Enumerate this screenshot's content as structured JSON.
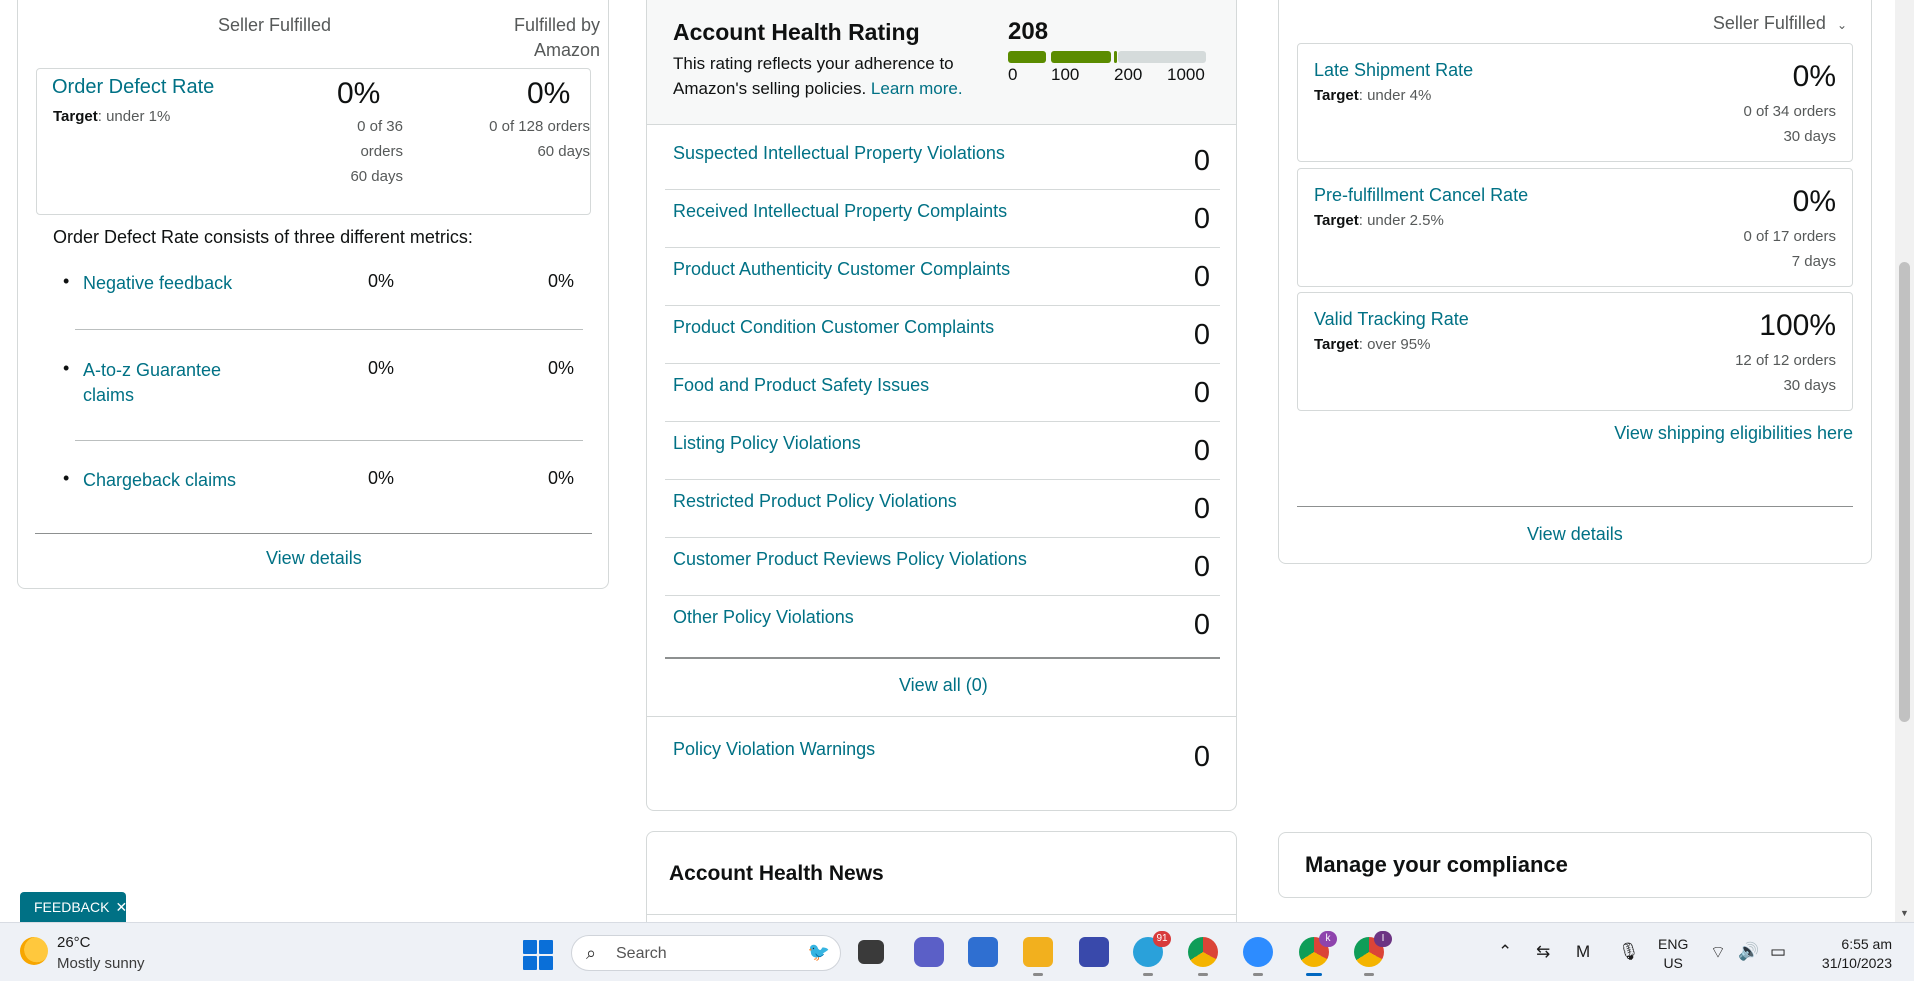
{
  "left_card": {
    "col_seller": "Seller Fulfilled",
    "col_amazon_1": "Fulfilled by",
    "col_amazon_2": "Amazon",
    "odr": {
      "title": "Order Defect Rate",
      "target_label": "Target",
      "target_value": ": under 1%",
      "seller_pct": "0%",
      "seller_meta_1": "0 of 36",
      "seller_meta_2": "orders",
      "seller_meta_3": "60 days",
      "amazon_pct": "0%",
      "amazon_meta_1": "0 of 128 orders",
      "amazon_meta_2": "60 days"
    },
    "consists_text": "Order Defect Rate consists of three different metrics:",
    "metrics": [
      {
        "name": "Negative feedback",
        "seller": "0%",
        "amazon": "0%"
      },
      {
        "name_1": "A-to-z Guarantee",
        "name_2": "claims",
        "seller": "0%",
        "amazon": "0%"
      },
      {
        "name": "Chargeback claims",
        "seller": "0%",
        "amazon": "0%"
      }
    ],
    "view_details": "View details"
  },
  "middle_card": {
    "title": "Account Health Rating",
    "desc_1": "This rating reflects your adherence to",
    "desc_2": "Amazon's selling policies.",
    "learn_more": "Learn more.",
    "score": "208",
    "ticks": [
      "0",
      "100",
      "200",
      "1000"
    ],
    "bar_colors": {
      "filled": "#5b8c00",
      "empty": "#d5dbdb"
    },
    "violations": [
      {
        "label": "Suspected Intellectual Property Violations",
        "count": "0"
      },
      {
        "label": "Received Intellectual Property Complaints",
        "count": "0"
      },
      {
        "label": "Product Authenticity Customer Complaints",
        "count": "0"
      },
      {
        "label": "Product Condition Customer Complaints",
        "count": "0"
      },
      {
        "label": "Food and Product Safety Issues",
        "count": "0"
      },
      {
        "label": "Listing Policy Violations",
        "count": "0"
      },
      {
        "label": "Restricted Product Policy Violations",
        "count": "0"
      },
      {
        "label": "Customer Product Reviews Policy Violations",
        "count": "0"
      },
      {
        "label": "Other Policy Violations",
        "count": "0"
      }
    ],
    "view_all": "View all (0)",
    "warnings": {
      "label": "Policy Violation Warnings",
      "count": "0"
    }
  },
  "news": {
    "title": "Account Health News"
  },
  "right_card": {
    "dropdown": "Seller Fulfilled",
    "metrics": [
      {
        "name": "Late Shipment Rate",
        "target_label": "Target",
        "target_value": ": under 4%",
        "pct": "0%",
        "meta_1": "0 of 34 orders",
        "meta_2": "30 days"
      },
      {
        "name": "Pre-fulfillment Cancel Rate",
        "target_label": "Target",
        "target_value": ": under 2.5%",
        "pct": "0%",
        "meta_1": "0 of 17 orders",
        "meta_2": "7 days"
      },
      {
        "name": "Valid Tracking Rate",
        "target_label": "Target",
        "target_value": ": over 95%",
        "pct": "100%",
        "meta_1": "12 of 12 orders",
        "meta_2": "30 days"
      }
    ],
    "ship_link": "View shipping eligibilities here",
    "view_details": "View details"
  },
  "compliance": {
    "title": "Manage your compliance"
  },
  "feedback": {
    "label": "FEEDBACK",
    "close": "✕"
  },
  "taskbar": {
    "weather_temp": "26°C",
    "weather_desc": "Mostly sunny",
    "search_placeholder": "Search",
    "telegram_badge": "91",
    "chrome_k_badge": "k",
    "chrome_i_badge": "I",
    "lang_1": "ENG",
    "lang_2": "US",
    "time": "6:55 am",
    "date": "31/10/2023"
  }
}
